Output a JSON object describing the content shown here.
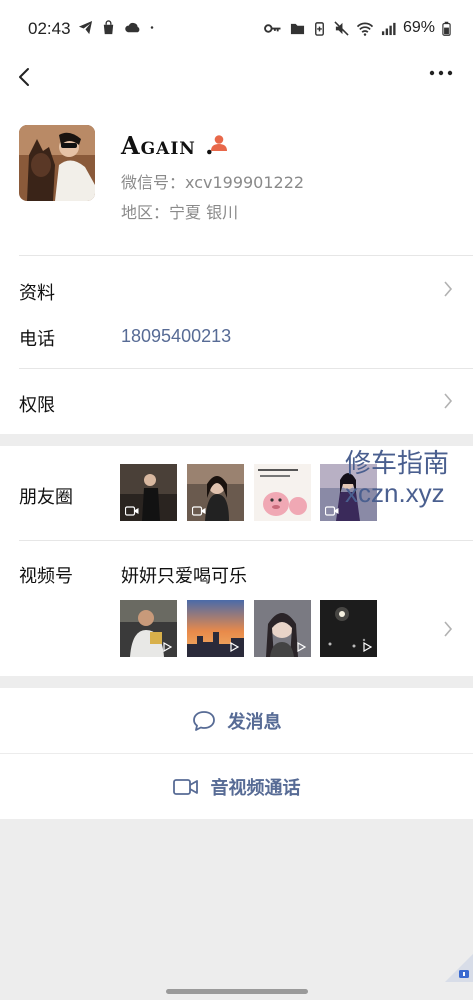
{
  "status_bar": {
    "time": "02:43",
    "battery": "69%",
    "left_icons": [
      "telegram-icon",
      "bag-icon",
      "cloud-icon",
      "dot-icon"
    ],
    "right_icons": [
      "key-icon",
      "folder-icon",
      "battery-saver-icon",
      "mute-icon",
      "wifi-icon",
      "signal-icon",
      "battery-icon"
    ]
  },
  "profile": {
    "name": "Again .",
    "wechat_id": "微信号：xcv199901222",
    "region": "地区：宁夏  银川"
  },
  "rows": {
    "info_label": "资料",
    "phone_label": "电话",
    "phone_value": "18095400213",
    "permission_label": "权限",
    "moments_label": "朋友圈",
    "channels_label": "视频号",
    "channels_name": "妍妍只爱喝可乐"
  },
  "watermark": {
    "line1": "修车指南",
    "line2": "xczn.xyz"
  },
  "actions": {
    "message": "发消息",
    "call": "音视频通话"
  },
  "colors": {
    "link": "#576b95",
    "background": "#ededed",
    "gender_icon": "#e8684a"
  }
}
